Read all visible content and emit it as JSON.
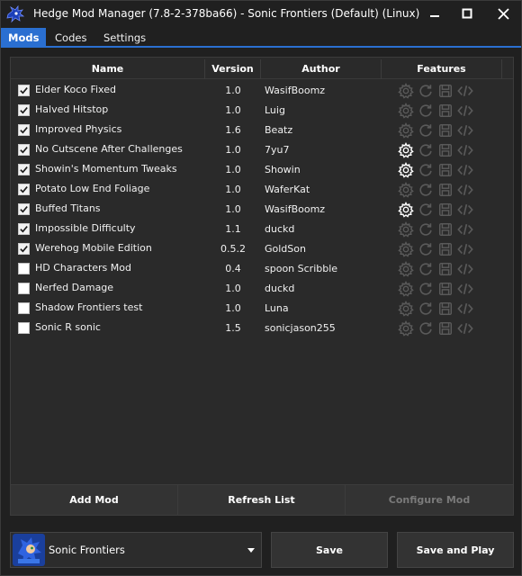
{
  "window": {
    "title": "Hedge Mod Manager (7.8-2-378ba66) - Sonic Frontiers (Default) (Linux)"
  },
  "tabs": [
    {
      "label": "Mods",
      "active": true
    },
    {
      "label": "Codes",
      "active": false
    },
    {
      "label": "Settings",
      "active": false
    }
  ],
  "grid": {
    "columns": [
      "Name",
      "Version",
      "Author",
      "Features"
    ],
    "rows": [
      {
        "enabled": true,
        "name": "Elder Koco Fixed",
        "version": "1.0",
        "author": "WasifBoomz",
        "configurable": false
      },
      {
        "enabled": true,
        "name": "Halved Hitstop",
        "version": "1.0",
        "author": "Luig",
        "configurable": false
      },
      {
        "enabled": true,
        "name": "Improved Physics",
        "version": "1.6",
        "author": "Beatz",
        "configurable": false
      },
      {
        "enabled": true,
        "name": "No Cutscene After Challenges",
        "version": "1.0",
        "author": "7yu7",
        "configurable": true
      },
      {
        "enabled": true,
        "name": "Showin's Momentum Tweaks",
        "version": "1.0",
        "author": "Showin",
        "configurable": true
      },
      {
        "enabled": true,
        "name": "Potato Low End Foliage",
        "version": "1.0",
        "author": "WaferKat",
        "configurable": false
      },
      {
        "enabled": true,
        "name": "Buffed Titans",
        "version": "1.0",
        "author": "WasifBoomz",
        "configurable": true
      },
      {
        "enabled": true,
        "name": "Impossible Difficulty",
        "version": "1.1",
        "author": "duckd",
        "configurable": false
      },
      {
        "enabled": true,
        "name": "Werehog Mobile Edition",
        "version": "0.5.2",
        "author": "GoldSon",
        "configurable": false
      },
      {
        "enabled": false,
        "name": "HD Characters Mod",
        "version": "0.4",
        "author": "spoon Scribble",
        "configurable": false
      },
      {
        "enabled": false,
        "name": "Nerfed Damage",
        "version": "1.0",
        "author": "duckd",
        "configurable": false
      },
      {
        "enabled": false,
        "name": "Shadow Frontiers test",
        "version": "1.0",
        "author": "Luna",
        "configurable": false
      },
      {
        "enabled": false,
        "name": "Sonic R sonic",
        "version": "1.5",
        "author": "sonicjason255",
        "configurable": false
      }
    ]
  },
  "panel_actions": {
    "add_mod": "Add Mod",
    "refresh_list": "Refresh List",
    "configure_mod": "Configure Mod"
  },
  "footer": {
    "game": "Sonic Frontiers",
    "save": "Save",
    "save_and_play": "Save and Play"
  },
  "colors": {
    "accent": "#2a6fd1",
    "background": "#202020",
    "panel": "#2a2a2a",
    "icon_disabled": "#5a5a5a",
    "icon_enabled": "#ffffff"
  }
}
